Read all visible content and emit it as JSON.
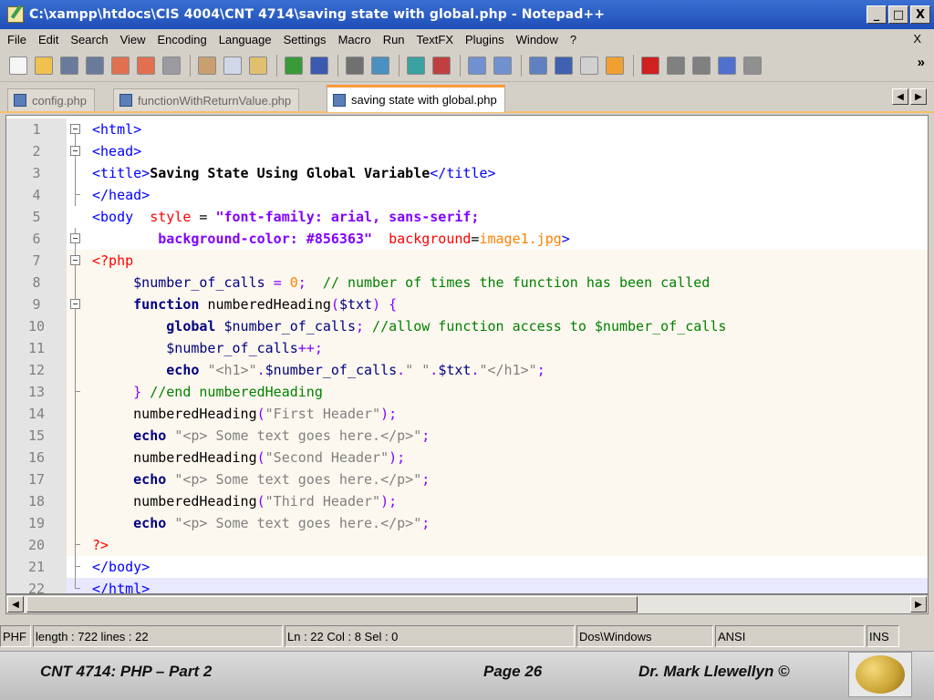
{
  "window": {
    "title": "C:\\xampp\\htdocs\\CIS 4004\\CNT 4714\\saving state with global.php - Notepad++",
    "buttons": [
      "_",
      "□",
      "X"
    ]
  },
  "menu": {
    "items": [
      "File",
      "Edit",
      "Search",
      "View",
      "Encoding",
      "Language",
      "Settings",
      "Macro",
      "Run",
      "TextFX",
      "Plugins",
      "Window",
      "?"
    ],
    "close": "X"
  },
  "toolbar": {
    "icons": [
      "new-file-icon",
      "open-file-icon",
      "save-icon",
      "save-all-icon",
      "close-icon",
      "close-all-icon",
      "print-icon",
      "cut-icon",
      "copy-icon",
      "paste-icon",
      "undo-icon",
      "redo-icon",
      "find-icon",
      "replace-icon",
      "zoom-in-icon",
      "zoom-out-icon",
      "sync-v-icon",
      "sync-h-icon",
      "wrap-icon",
      "all-chars-icon",
      "indent-guide-icon",
      "udl-icon",
      "record-icon",
      "stop-icon",
      "play-icon",
      "play-multi-icon",
      "save-macro-icon"
    ],
    "more": "»"
  },
  "tabs": [
    {
      "label": "config.php",
      "active": false
    },
    {
      "label": "functionWithReturnValue.php",
      "active": false
    },
    {
      "label": "saving state with global.php",
      "active": true
    }
  ],
  "editor": {
    "lines": [
      {
        "n": "1",
        "fold": "box",
        "parts": [
          [
            "t-tag",
            "<html>"
          ]
        ]
      },
      {
        "n": "2",
        "fold": "box",
        "parts": [
          [
            "t-tag",
            "<head>"
          ]
        ]
      },
      {
        "n": "3",
        "fold": "line",
        "parts": [
          [
            "t-tag",
            "<title>"
          ],
          [
            "t-text",
            "Saving State Using Global Variable"
          ],
          [
            "t-tag",
            "</title>"
          ]
        ]
      },
      {
        "n": "4",
        "fold": "end",
        "parts": [
          [
            "t-tag",
            "</head>"
          ]
        ]
      },
      {
        "n": "5",
        "fold": "none",
        "parts": [
          [
            "t-tag",
            "<body  "
          ],
          [
            "t-attr",
            "style"
          ],
          [
            "t-fn",
            " = "
          ],
          [
            "t-val",
            "\"font-family: arial, sans-serif;"
          ]
        ]
      },
      {
        "n": "6",
        "fold": "box",
        "parts": [
          [
            "t-val",
            "        background-color: #856363\"  "
          ],
          [
            "t-attr",
            "background"
          ],
          [
            "t-fn",
            "="
          ],
          [
            "t-img",
            "image1.jpg"
          ],
          [
            "t-tag",
            ">"
          ]
        ]
      },
      {
        "n": "7",
        "fold": "box",
        "php": true,
        "parts": [
          [
            "t-php",
            "<?php"
          ]
        ]
      },
      {
        "n": "8",
        "fold": "line",
        "php": true,
        "parts": [
          [
            "t-var",
            "     $number_of_calls "
          ],
          [
            "t-op",
            "="
          ],
          [
            "t-num",
            " 0"
          ],
          [
            "t-op",
            ";"
          ],
          [
            "t-cmt",
            "  // number of times the function has been called"
          ]
        ]
      },
      {
        "n": "9",
        "fold": "box",
        "php": true,
        "parts": [
          [
            "t-kw",
            "     function "
          ],
          [
            "t-fn",
            "numberedHeading"
          ],
          [
            "t-op",
            "("
          ],
          [
            "t-var",
            "$txt"
          ],
          [
            "t-op",
            ") {"
          ]
        ]
      },
      {
        "n": "10",
        "fold": "line",
        "php": true,
        "parts": [
          [
            "t-kw",
            "         global "
          ],
          [
            "t-var",
            "$number_of_calls"
          ],
          [
            "t-op",
            ";"
          ],
          [
            "t-cmt",
            " //allow function access to $number_of_calls"
          ]
        ]
      },
      {
        "n": "11",
        "fold": "line",
        "php": true,
        "parts": [
          [
            "t-var",
            "         $number_of_calls"
          ],
          [
            "t-op",
            "++;"
          ]
        ]
      },
      {
        "n": "12",
        "fold": "line",
        "php": true,
        "parts": [
          [
            "t-kw",
            "         echo "
          ],
          [
            "t-str",
            "\"<h1>\""
          ],
          [
            "t-op",
            "."
          ],
          [
            "t-var",
            "$number_of_calls"
          ],
          [
            "t-op",
            "."
          ],
          [
            "t-str",
            "\" \""
          ],
          [
            "t-op",
            "."
          ],
          [
            "t-var",
            "$txt"
          ],
          [
            "t-op",
            "."
          ],
          [
            "t-str",
            "\"</h1>\""
          ],
          [
            "t-op",
            ";"
          ]
        ]
      },
      {
        "n": "13",
        "fold": "end",
        "php": true,
        "parts": [
          [
            "t-op",
            "     } "
          ],
          [
            "t-cmt",
            "//end numberedHeading"
          ]
        ]
      },
      {
        "n": "14",
        "fold": "line",
        "php": true,
        "parts": [
          [
            "t-fn",
            "     numberedHeading"
          ],
          [
            "t-op",
            "("
          ],
          [
            "t-str",
            "\"First Header\""
          ],
          [
            "t-op",
            ");"
          ]
        ]
      },
      {
        "n": "15",
        "fold": "line",
        "php": true,
        "parts": [
          [
            "t-kw",
            "     echo "
          ],
          [
            "t-str",
            "\"<p> Some text goes here.</p>\""
          ],
          [
            "t-op",
            ";"
          ]
        ]
      },
      {
        "n": "16",
        "fold": "line",
        "php": true,
        "parts": [
          [
            "t-fn",
            "     numberedHeading"
          ],
          [
            "t-op",
            "("
          ],
          [
            "t-str",
            "\"Second Header\""
          ],
          [
            "t-op",
            ");"
          ]
        ]
      },
      {
        "n": "17",
        "fold": "line",
        "php": true,
        "parts": [
          [
            "t-kw",
            "     echo "
          ],
          [
            "t-str",
            "\"<p> Some text goes here.</p>\""
          ],
          [
            "t-op",
            ";"
          ]
        ]
      },
      {
        "n": "18",
        "fold": "line",
        "php": true,
        "parts": [
          [
            "t-fn",
            "     numberedHeading"
          ],
          [
            "t-op",
            "("
          ],
          [
            "t-str",
            "\"Third Header\""
          ],
          [
            "t-op",
            ");"
          ]
        ]
      },
      {
        "n": "19",
        "fold": "line",
        "php": true,
        "parts": [
          [
            "t-kw",
            "     echo "
          ],
          [
            "t-str",
            "\"<p> Some text goes here.</p>\""
          ],
          [
            "t-op",
            ";"
          ]
        ]
      },
      {
        "n": "20",
        "fold": "end",
        "php": true,
        "parts": [
          [
            "t-php",
            "?>"
          ]
        ]
      },
      {
        "n": "21",
        "fold": "end",
        "parts": [
          [
            "t-tag",
            "</body>"
          ]
        ]
      },
      {
        "n": "22",
        "fold": "last",
        "current": true,
        "parts": [
          [
            "t-tag",
            "</html>"
          ]
        ]
      }
    ]
  },
  "statusbar": {
    "lang": "PHF",
    "length": "length : 722   lines : 22",
    "position": "Ln : 22   Col : 8   Sel : 0",
    "eol": "Dos\\Windows",
    "encoding": "ANSI",
    "mode": "INS"
  },
  "footer": {
    "course": "CNT 4714:  PHP – Part 2",
    "page": "Page 26",
    "author": "Dr. Mark Llewellyn ©"
  }
}
